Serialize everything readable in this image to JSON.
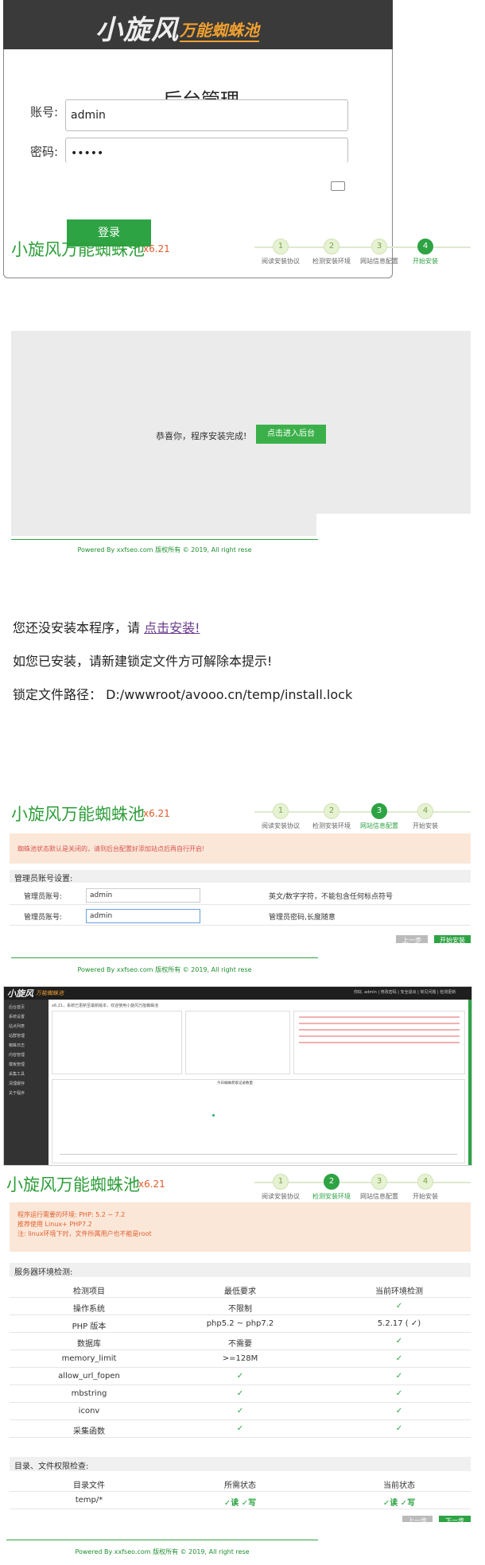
{
  "login": {
    "logo_main": "小旋风",
    "logo_sub": "万能蜘蛛池",
    "title": "后台管理",
    "username_label": "账号:",
    "username_value": "admin",
    "password_label": "密码:",
    "password_value": "•••••",
    "submit": "登录"
  },
  "header": {
    "brand": "小旋风万能蜘蛛池",
    "version": "x6.21",
    "steps": [
      {
        "n": "1",
        "label": "阅读安装协议"
      },
      {
        "n": "2",
        "label": "检测安装环境"
      },
      {
        "n": "3",
        "label": "网站信息配置"
      },
      {
        "n": "4",
        "label": "开始安装"
      }
    ]
  },
  "done": {
    "message": "恭喜你，程序安装完成!",
    "button": "点击进入后台",
    "footer": "Powered By xxfseo.com 版权所有 © 2019, All right rese"
  },
  "notinstalled": {
    "line1_prefix": "您还没安装本程序，请 ",
    "line1_link": "点击安装!",
    "line2": "如您已安装，请新建锁定文件方可解除本提示!",
    "line3": "锁定文件路径：  D:/wwwroot/avooo.cn/temp/install.lock"
  },
  "config": {
    "warning": "蜘蛛池状态默认是关闭的，请到后台配置好添加站点后再自行开启!",
    "section": "管理员账号设置:",
    "rows": [
      {
        "label": "管理员账号:",
        "value": "admin",
        "hint": "英文/数字字符，不能包含任何标点符号"
      },
      {
        "label": "管理员账号:",
        "value": "admin",
        "hint": "管理员密码,长度随意"
      }
    ],
    "prev": "上一步",
    "next": "开始安装",
    "footer": "Powered By xxfseo.com 版权所有 © 2019, All right rese"
  },
  "admin": {
    "logo": "小旋风",
    "logo_sub": "万能蜘蛛池",
    "user": "你好, admin  |  修改密码  |  安全退出  |  常见问题  |  检测更新",
    "sidebar": [
      "后台首页",
      "系统设置",
      "站点列表",
      "站群管理",
      "蜘蛛日志",
      "内容管理",
      "模板管理",
      "采集工具",
      "清理缓存",
      "关于程序"
    ],
    "notice": "x6.21，系统已更新至最新版本，欢迎使用小旋风万能蜘蛛池",
    "chart_title": "今日蜘蛛爬取记录数量"
  },
  "env": {
    "info": [
      "程序运行需要的环境: PHP: 5.2 ~ 7.2",
      "推荐使用 Linux+ PHP7.2",
      "注: linux环境下时，文件所属用户也不能是root"
    ],
    "section1": "服务器环境检测:",
    "headers": [
      "检测项目",
      "最低要求",
      "当前环境检测"
    ],
    "rows": [
      [
        "操作系统",
        "不限制",
        "✓"
      ],
      [
        "PHP 版本",
        "php5.2 ~ php7.2",
        "5.2.17 ( ✓)"
      ],
      [
        "数据库",
        "不需要",
        "✓"
      ],
      [
        "memory_limit",
        ">=128M",
        "✓"
      ],
      [
        "allow_url_fopen",
        "✓",
        "✓"
      ],
      [
        "mbstring",
        "✓",
        "✓"
      ],
      [
        "iconv",
        "✓",
        "✓"
      ],
      [
        "采集函数",
        "✓",
        "✓"
      ]
    ],
    "section2": "目录、文件权限检查:",
    "headers2": [
      "目录文件",
      "所需状态",
      "当前状态"
    ],
    "rows2": [
      [
        "temp/*",
        "✓读 ✓写",
        "✓读 ✓写"
      ]
    ],
    "prev": "上一步",
    "next": "下一步",
    "footer": "Powered By xxfseo.com 版权所有 © 2019, All right rese"
  }
}
